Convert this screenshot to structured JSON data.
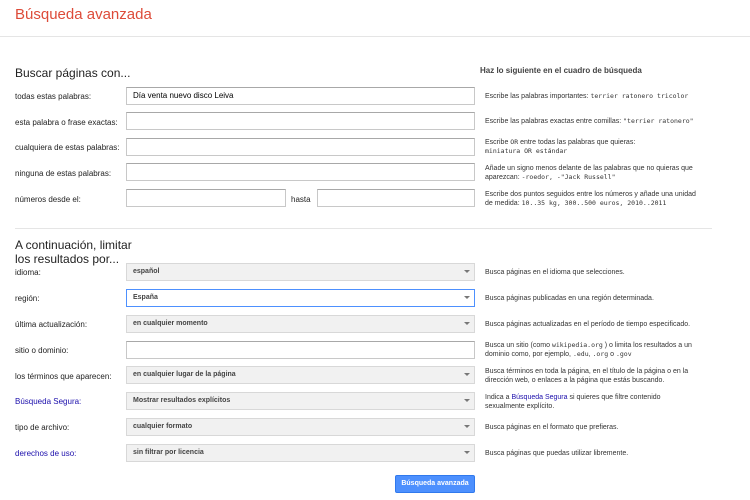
{
  "header": {
    "title": "Búsqueda avanzada"
  },
  "find": {
    "heading": "Buscar páginas con...",
    "hint_heading": "Haz lo siguiente en el cuadro de búsqueda",
    "all_words": {
      "label": "todas estas palabras:",
      "value": "Día venta nuevo disco Leiva",
      "hint": "Escribe las palabras importantes:",
      "hint_code": "terrier ratonero tricolor"
    },
    "exact": {
      "label": "esta palabra o frase exactas:",
      "hint": "Escribe las palabras exactas entre comillas:",
      "hint_code": "\"terrier ratonero\""
    },
    "any": {
      "label": "cualquiera de estas palabras:",
      "hint_a": "Escribe",
      "hint_or": "OR",
      "hint_b": "entre todas las palabras que quieras:",
      "hint_code": "miniatura OR estándar"
    },
    "none": {
      "label": "ninguna de estas palabras:",
      "hint": "Añade un signo menos delante de las palabras que no quieras que aparezcan:",
      "hint_code": "-roedor, -\"Jack Russell\""
    },
    "range": {
      "label": "números desde el:",
      "to_label": "hasta",
      "hint": "Escribe dos puntos seguidos entre los números y añade una unidad de medida:",
      "hint_code": "10..35 kg, 300..500 euros, 2010..2011"
    }
  },
  "narrow": {
    "heading": "A continuación, limitar los resultados por...",
    "language": {
      "label": "idioma:",
      "value": "español",
      "hint": "Busca páginas en el idioma que selecciones."
    },
    "region": {
      "label": "región:",
      "value": "España",
      "hint": "Busca páginas publicadas en una región determinada."
    },
    "last_update": {
      "label": "última actualización:",
      "value": "en cualquier momento",
      "hint": "Busca páginas actualizadas en el período de tiempo especificado."
    },
    "site": {
      "label": "sitio o dominio:",
      "hint_a": "Busca un sitio (como",
      "hint_code1": "wikipedia.org",
      "hint_b": ") o limita los resultados a un dominio como, por ejemplo,",
      "hint_code2": ".edu",
      "hint_sep": ",",
      "hint_code3": ".org",
      "hint_c": "o",
      "hint_code4": ".gov"
    },
    "terms": {
      "label": "los términos que aparecen:",
      "value": "en cualquier lugar de la página",
      "hint": "Busca términos en toda la página, en el título de la página o en la dirección web, o enlaces a la página que estás buscando."
    },
    "safe": {
      "label": "Búsqueda Segura:",
      "value": "Mostrar resultados explícitos",
      "hint_a": "Indica a",
      "hint_link": "Búsqueda Segura",
      "hint_b": "si quieres que filtre contenido sexualmente explícito."
    },
    "filetype": {
      "label": "tipo de archivo:",
      "value": "cualquier formato",
      "hint": "Busca páginas en el formato que prefieras."
    },
    "rights": {
      "label": "derechos de uso:",
      "value": "sin filtrar por licencia",
      "hint": "Busca páginas que puedas utilizar libremente."
    }
  },
  "submit_label": "Búsqueda avanzada",
  "colors": {
    "accent": "#dd4b39",
    "link": "#1a0dab",
    "button": "#4d90fe"
  }
}
